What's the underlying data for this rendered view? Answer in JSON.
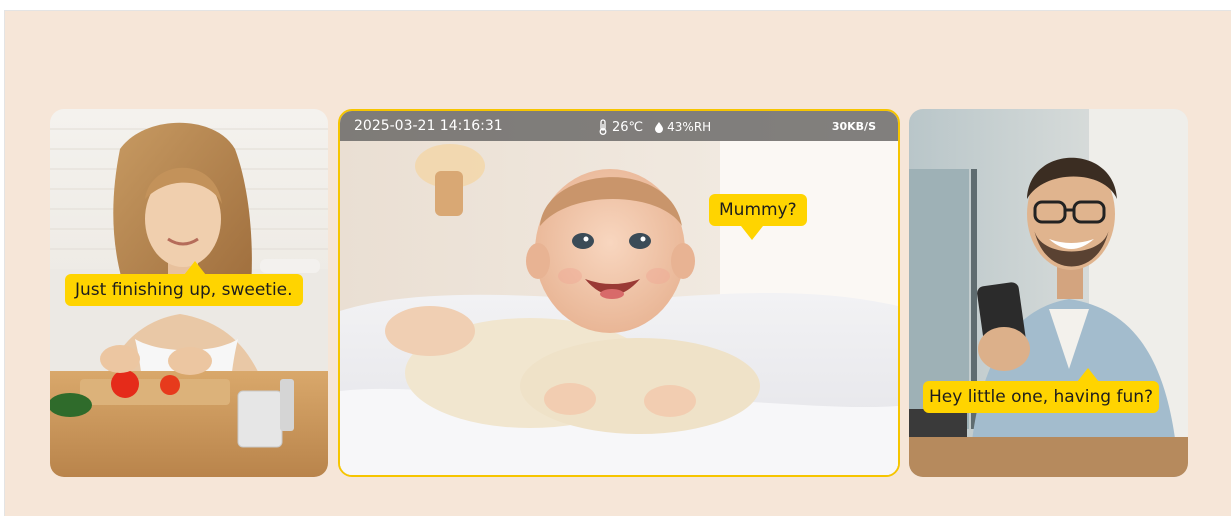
{
  "panels": {
    "left": {
      "speech": "Just finishing up, sweetie."
    },
    "middle": {
      "speech": "Mummy?",
      "hud": {
        "datetime": "2025-03-21  14:16:31",
        "temperature": "26℃",
        "humidity": "43%RH",
        "bitrate": "30KB/S"
      }
    },
    "right": {
      "speech": "Hey little one, having fun?"
    }
  },
  "colors": {
    "background": "#f6e6d8",
    "accent": "#ffd400",
    "frame": "#f6c500"
  },
  "icons": [
    "thermometer-icon",
    "droplet-icon"
  ]
}
